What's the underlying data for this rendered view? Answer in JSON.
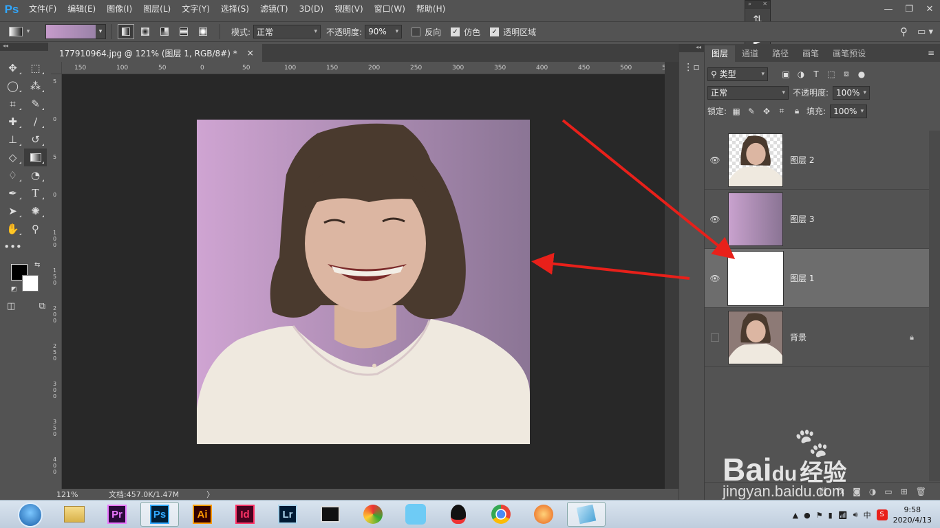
{
  "app": {
    "logo": "Ps",
    "menu": [
      "文件(F)",
      "编辑(E)",
      "图像(I)",
      "图层(L)",
      "文字(Y)",
      "选择(S)",
      "滤镜(T)",
      "3D(D)",
      "视图(V)",
      "窗口(W)",
      "帮助(H)"
    ]
  },
  "options": {
    "mode_label": "模式:",
    "mode_value": "正常",
    "opacity_label": "不透明度:",
    "opacity_value": "90%",
    "reverse_label": "反向",
    "dither_label": "仿色",
    "transparency_label": "透明区域",
    "reverse_checked": false,
    "dither_checked": true,
    "transparency_checked": true
  },
  "document": {
    "tab_title": "177910964.jpg @ 121% (图层 1, RGB/8#) *",
    "tab_close": "×",
    "zoom": "121%",
    "doc_info": "文档:457.0K/1.47M",
    "status_arrow": "〉",
    "ruler_top": [
      "150",
      "100",
      "50",
      "0",
      "50",
      "100",
      "150",
      "200",
      "250",
      "300",
      "350",
      "400",
      "450",
      "500",
      "55"
    ],
    "ruler_left": [
      "5",
      "0",
      "5",
      "0",
      "1 0 0",
      "1 5 0",
      "2 0 0",
      "2 5 0",
      "3 0 0",
      "3 5 0",
      "4 0 0"
    ]
  },
  "layers_panel": {
    "tabs": [
      "图层",
      "通道",
      "路径",
      "画笔",
      "画笔预设"
    ],
    "filter_value": "类型",
    "blend_mode": "正常",
    "opacity_label": "不透明度:",
    "opacity_value": "100%",
    "lock_label": "锁定:",
    "fill_label": "填充:",
    "fill_value": "100%",
    "layers": [
      {
        "name": "图层 2",
        "visible": true,
        "selected": false,
        "locked": false
      },
      {
        "name": "图层 3",
        "visible": true,
        "selected": false,
        "locked": false
      },
      {
        "name": "图层 1",
        "visible": true,
        "selected": true,
        "locked": false
      },
      {
        "name": "背景",
        "visible": false,
        "selected": false,
        "locked": true
      }
    ]
  },
  "watermark": {
    "brand": "Bai",
    "brand2": "du",
    "suffix": "经验",
    "url": "jingyan.baidu.com"
  },
  "taskbar": {
    "apps": [
      "Pr",
      "Ps",
      "Ai",
      "Id",
      "Lr"
    ],
    "ime": "中",
    "time": "9:58",
    "date": "2020/4/13"
  },
  "colors": {
    "accent_red": "#e8201a",
    "ps_blue": "#31a8ff"
  }
}
